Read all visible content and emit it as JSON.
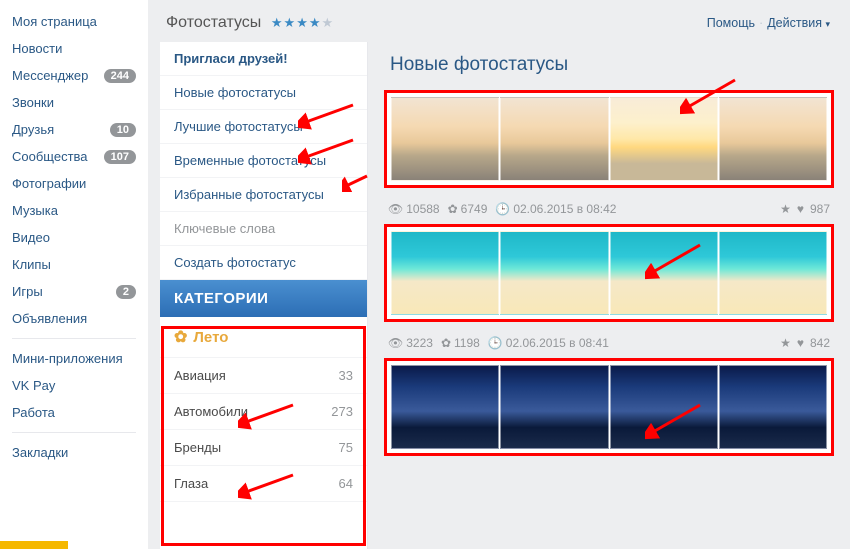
{
  "leftnav": {
    "items": [
      {
        "label": "Моя страница",
        "badge": null
      },
      {
        "label": "Новости",
        "badge": null
      },
      {
        "label": "Мессенджер",
        "badge": "244"
      },
      {
        "label": "Звонки",
        "badge": null
      },
      {
        "label": "Друзья",
        "badge": "10"
      },
      {
        "label": "Сообщества",
        "badge": "107"
      },
      {
        "label": "Фотографии",
        "badge": null
      },
      {
        "label": "Музыка",
        "badge": null
      },
      {
        "label": "Видео",
        "badge": null
      },
      {
        "label": "Клипы",
        "badge": null
      },
      {
        "label": "Игры",
        "badge": "2"
      },
      {
        "label": "Объявления",
        "badge": null
      }
    ],
    "items2": [
      {
        "label": "Мини-приложения"
      },
      {
        "label": "VK Pay"
      },
      {
        "label": "Работа"
      }
    ],
    "items3": [
      {
        "label": "Закладки"
      }
    ]
  },
  "topbar": {
    "title": "Фотостатусы",
    "rating": 4,
    "help": "Помощь",
    "actions": "Действия"
  },
  "sidebar": {
    "invite": "Пригласи друзей!",
    "links": [
      "Новые фотостатусы",
      "Лучшие фотостатусы",
      "Временные фотостатусы",
      "Избранные фотостатусы",
      "Ключевые слова",
      "Создать фотостатус"
    ],
    "cat_header": "КАТЕГОРИИ",
    "featured": "Лето",
    "cats": [
      {
        "name": "Авиация",
        "count": "33"
      },
      {
        "name": "Автомобили",
        "count": "273"
      },
      {
        "name": "Бренды",
        "count": "75"
      },
      {
        "name": "Глаза",
        "count": "64"
      }
    ]
  },
  "content": {
    "title": "Новые фотостатусы",
    "posts": [
      {
        "views": "10588",
        "comments": "6749",
        "date": "02.06.2015 в 08:42",
        "likes": "987"
      },
      {
        "views": "3223",
        "comments": "1198",
        "date": "02.06.2015 в 08:41",
        "likes": "842"
      }
    ]
  }
}
